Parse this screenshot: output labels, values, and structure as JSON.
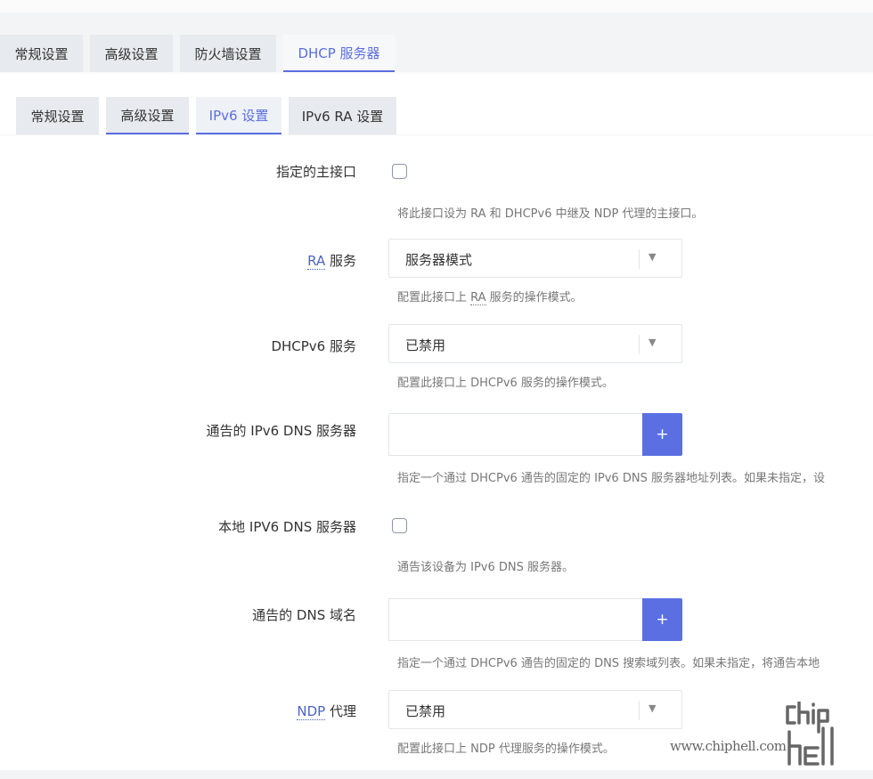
{
  "top_tabs": [
    {
      "label": "常规设置",
      "active": false
    },
    {
      "label": "高级设置",
      "active": false
    },
    {
      "label": "防火墙设置",
      "active": false
    },
    {
      "label": "DHCP 服务器",
      "active": true
    }
  ],
  "sub_tabs": [
    {
      "label": "常规设置",
      "active": false
    },
    {
      "label": "高级设置",
      "active": false
    },
    {
      "label": "IPv6 设置",
      "active": true
    },
    {
      "label": "IPv6 RA 设置",
      "active": false
    }
  ],
  "fields": {
    "master": {
      "label": "指定的主接口",
      "checked": false,
      "desc": "将此接口设为 RA 和 DHCPv6 中继及 NDP 代理的主接口。"
    },
    "ra_service": {
      "label_abbr": "RA",
      "label_rest": " 服务",
      "value": "服务器模式",
      "desc_prefix": "配置此接口上 ",
      "desc_abbr": "RA",
      "desc_suffix": " 服务的操作模式。"
    },
    "dhcpv6_service": {
      "label": "DHCPv6 服务",
      "value": "已禁用",
      "desc": "配置此接口上 DHCPv6 服务的操作模式。"
    },
    "ipv6_dns": {
      "label": "通告的 IPv6 DNS 服务器",
      "value": "",
      "button": "+",
      "desc": "指定一个通过 DHCPv6 通告的固定的 IPv6 DNS 服务器地址列表。如果未指定，设"
    },
    "local_ipv6_dns": {
      "label": "本地 IPV6 DNS 服务器",
      "checked": false,
      "desc": "通告该设备为 IPv6 DNS 服务器。"
    },
    "dns_domain": {
      "label": "通告的 DNS 域名",
      "value": "",
      "button": "+",
      "desc": "指定一个通过 DHCPv6 通告的固定的 DNS 搜索域列表。如果未指定，将通告本地"
    },
    "ndp_proxy": {
      "label_abbr": "NDP",
      "label_rest": " 代理",
      "value": "已禁用",
      "desc": "配置此接口上 NDP 代理服务的操作模式。"
    }
  },
  "watermark": {
    "url": "www.chiphell.com"
  },
  "colors": {
    "accent": "#5b6fe3",
    "tab_bg": "#e7eaee"
  }
}
